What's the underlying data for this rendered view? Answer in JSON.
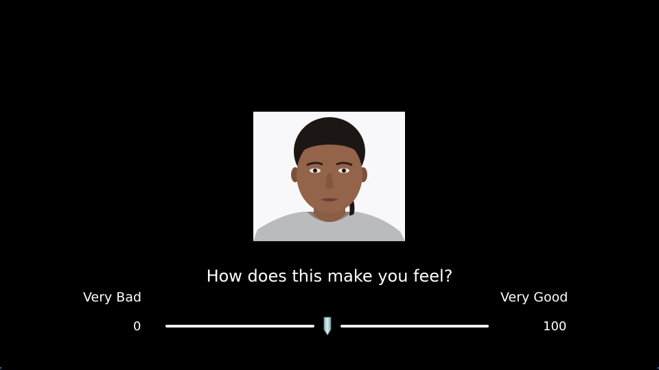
{
  "stimulus": {
    "image_alt": "Portrait photograph of a woman with dark hair pulled back, neutral expression, wearing a grey t-shirt, white background"
  },
  "prompt": {
    "question": "How does this make you feel?"
  },
  "scale": {
    "left_anchor": "Very Bad",
    "right_anchor": "Very Good",
    "min_label": "0",
    "max_label": "100",
    "min": 0,
    "max": 100,
    "value": 50
  },
  "colors": {
    "background": "#000000",
    "text": "#ffffff",
    "track": "#f0f0f0",
    "thumb": "#b9d3d6"
  }
}
